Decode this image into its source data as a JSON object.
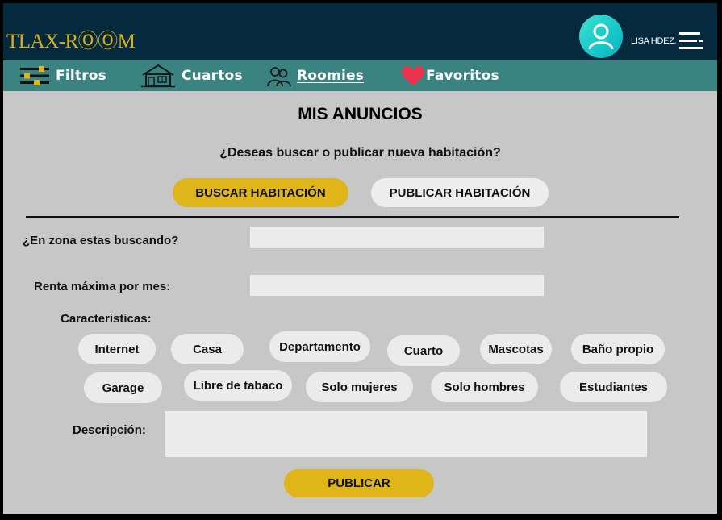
{
  "header": {
    "logo": "TLAX-RⓄⓄM",
    "username": "LISA HDEZ."
  },
  "nav": {
    "items": [
      {
        "label": "Filtros",
        "icon": "filter-lines-icon"
      },
      {
        "label": "Cuartos",
        "icon": "house-icon"
      },
      {
        "label": "Roomies",
        "icon": "people-icon",
        "active": true
      },
      {
        "label": "Favoritos",
        "icon": "heart-icon"
      }
    ]
  },
  "page": {
    "title": "MIS ANUNCIOS",
    "question": "¿Deseas buscar o publicar nueva habitación?",
    "search_button": "BUSCAR HABITACIÓN",
    "publish_toggle_button": "PUBLICAR HABITACIÓN"
  },
  "form": {
    "zone_label": "¿En zona estas buscando?",
    "zone_value": "",
    "rent_label": "Renta máxima por mes:",
    "rent_value": "",
    "features_label": "Caracteristicas:",
    "features": [
      "Internet",
      "Casa",
      "Departamento",
      "Cuarto",
      "Mascotas",
      "Baño propio",
      "Garage",
      "Libre de tabaco",
      "Solo mujeres",
      "Solo hombres",
      "Estudiantes"
    ],
    "description_label": "Descripción:",
    "description_value": "",
    "submit_label": "PUBLICAR"
  },
  "colors": {
    "header_bg": "#052a3d",
    "nav_bg": "#3a8381",
    "accent_yellow": "#e0b51a",
    "heart": "#e8334a",
    "avatar": "#16c7c9"
  }
}
